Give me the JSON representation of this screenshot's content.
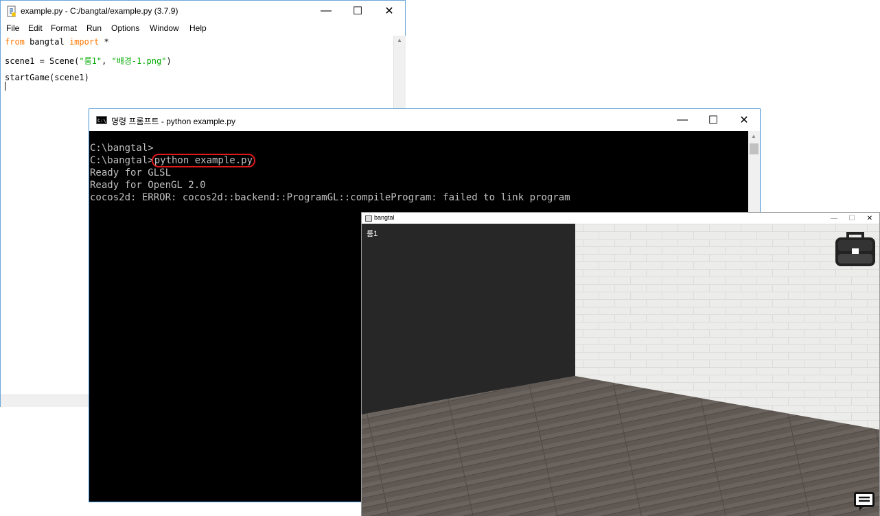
{
  "idle": {
    "title": "example.py - C:/bangtal/example.py (3.7.9)",
    "menu": [
      "File",
      "Edit",
      "Format",
      "Run",
      "Options",
      "Window",
      "Help"
    ],
    "code": {
      "line1": {
        "kw1": "from",
        "mid": " bangtal ",
        "kw2": "import",
        "end": " *"
      },
      "line2": {
        "pre": "scene1 = Scene(",
        "s1": "\"룸1\"",
        "comma": ", ",
        "s2": "\"배경-1.png\"",
        "post": ")"
      },
      "line3": "startGame(scene1)"
    }
  },
  "cmd": {
    "title": "명령 프롬프트 - python  example.py",
    "lines": {
      "l1": "C:\\bangtal>",
      "l2_prompt": "C:\\bangtal>",
      "l2_cmd": "python example.py",
      "l3": "Ready for GLSL",
      "l4": "Ready for OpenGL 2.0",
      "l5": "cocos2d: ERROR: cocos2d::backend::ProgramGL::compileProgram: failed to link program"
    }
  },
  "game": {
    "title": "bangtal",
    "scene_label": "룸1",
    "icons": {
      "inventory": "briefcase-icon",
      "message": "chat-icon"
    }
  },
  "colors": {
    "highlight": "#e01818",
    "keyword": "#ff7700",
    "string": "#00aa00"
  }
}
